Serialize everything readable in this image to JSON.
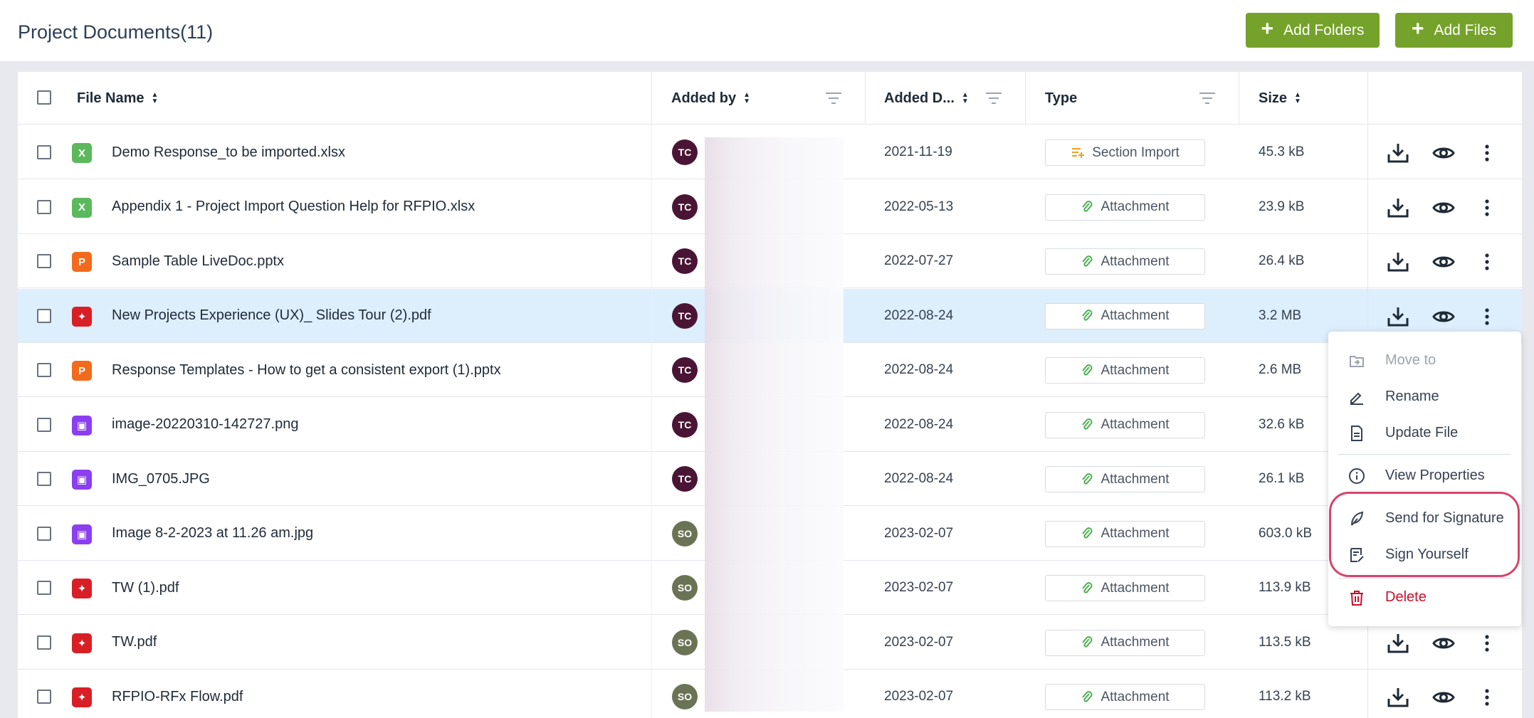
{
  "header": {
    "title": "Project Documents(11)",
    "add_folders_label": "Add Folders",
    "add_files_label": "Add Files",
    "button_color": "#75a22a"
  },
  "table": {
    "columns": {
      "file_name": "File Name",
      "added_by": "Added by",
      "added_date": "Added D...",
      "type": "Type",
      "size": "Size"
    },
    "rows": [
      {
        "name": "Demo Response_to be imported.xlsx",
        "file_type": "excel",
        "initials": "TC",
        "date": "2021-11-19",
        "type": "Section Import",
        "type_icon": "section-import-icon",
        "size": "45.3 kB",
        "selected": false
      },
      {
        "name": "Appendix 1 - Project Import Question Help for RFPIO.xlsx",
        "file_type": "excel",
        "initials": "TC",
        "date": "2022-05-13",
        "type": "Attachment",
        "type_icon": "paperclip-icon",
        "size": "23.9 kB",
        "selected": false
      },
      {
        "name": "Sample Table LiveDoc.pptx",
        "file_type": "powerpoint",
        "initials": "TC",
        "date": "2022-07-27",
        "type": "Attachment",
        "type_icon": "paperclip-icon",
        "size": "26.4 kB",
        "selected": false
      },
      {
        "name": "New Projects Experience (UX)_ Slides Tour (2).pdf",
        "file_type": "pdf",
        "initials": "TC",
        "date": "2022-08-24",
        "type": "Attachment",
        "type_icon": "paperclip-icon",
        "size": "3.2 MB",
        "selected": true
      },
      {
        "name": "Response Templates - How to get a consistent export (1).pptx",
        "file_type": "powerpoint",
        "initials": "TC",
        "date": "2022-08-24",
        "type": "Attachment",
        "type_icon": "paperclip-icon",
        "size": "2.6 MB",
        "selected": false
      },
      {
        "name": "image-20220310-142727.png",
        "file_type": "image",
        "initials": "TC",
        "date": "2022-08-24",
        "type": "Attachment",
        "type_icon": "paperclip-icon",
        "size": "32.6 kB",
        "selected": false
      },
      {
        "name": "IMG_0705.JPG",
        "file_type": "image",
        "initials": "TC",
        "date": "2022-08-24",
        "type": "Attachment",
        "type_icon": "paperclip-icon",
        "size": "26.1 kB",
        "selected": false
      },
      {
        "name": "Image 8-2-2023 at 11.26 am.jpg",
        "file_type": "image",
        "initials": "SO",
        "date": "2023-02-07",
        "type": "Attachment",
        "type_icon": "paperclip-icon",
        "size": "603.0 kB",
        "selected": false
      },
      {
        "name": "TW (1).pdf",
        "file_type": "pdf",
        "initials": "SO",
        "date": "2023-02-07",
        "type": "Attachment",
        "type_icon": "paperclip-icon",
        "size": "113.9 kB",
        "selected": false
      },
      {
        "name": "TW.pdf",
        "file_type": "pdf",
        "initials": "SO",
        "date": "2023-02-07",
        "type": "Attachment",
        "type_icon": "paperclip-icon",
        "size": "113.5 kB",
        "selected": false
      },
      {
        "name": "RFPIO-RFx Flow.pdf",
        "file_type": "pdf",
        "initials": "SO",
        "date": "2023-02-07",
        "type": "Attachment",
        "type_icon": "paperclip-icon",
        "size": "113.2 kB",
        "selected": false
      }
    ]
  },
  "context_menu": {
    "items": [
      {
        "label": "Move to",
        "icon": "move-to-icon",
        "disabled": true
      },
      {
        "label": "Rename",
        "icon": "pencil-icon"
      },
      {
        "label": "Update File",
        "icon": "document-icon"
      },
      {
        "label": "View Properties",
        "icon": "info-icon"
      },
      {
        "label": "Send for Signature",
        "icon": "feather-pen-icon"
      },
      {
        "label": "Sign Yourself",
        "icon": "sign-edit-icon"
      },
      {
        "label": "Delete",
        "icon": "trash-icon",
        "danger": true
      }
    ]
  },
  "colors": {
    "excel": "#5cb85c",
    "powerpoint": "#f26b1d",
    "pdf": "#d91f26",
    "image": "#8b3ff0",
    "avatar_TC": "#4a1535",
    "avatar_SO": "#6b7355",
    "section_import_icon": "#f0a020",
    "attachment_icon": "#4caf50",
    "highlight_ring": "#d9436b",
    "delete": "#c8102e"
  }
}
